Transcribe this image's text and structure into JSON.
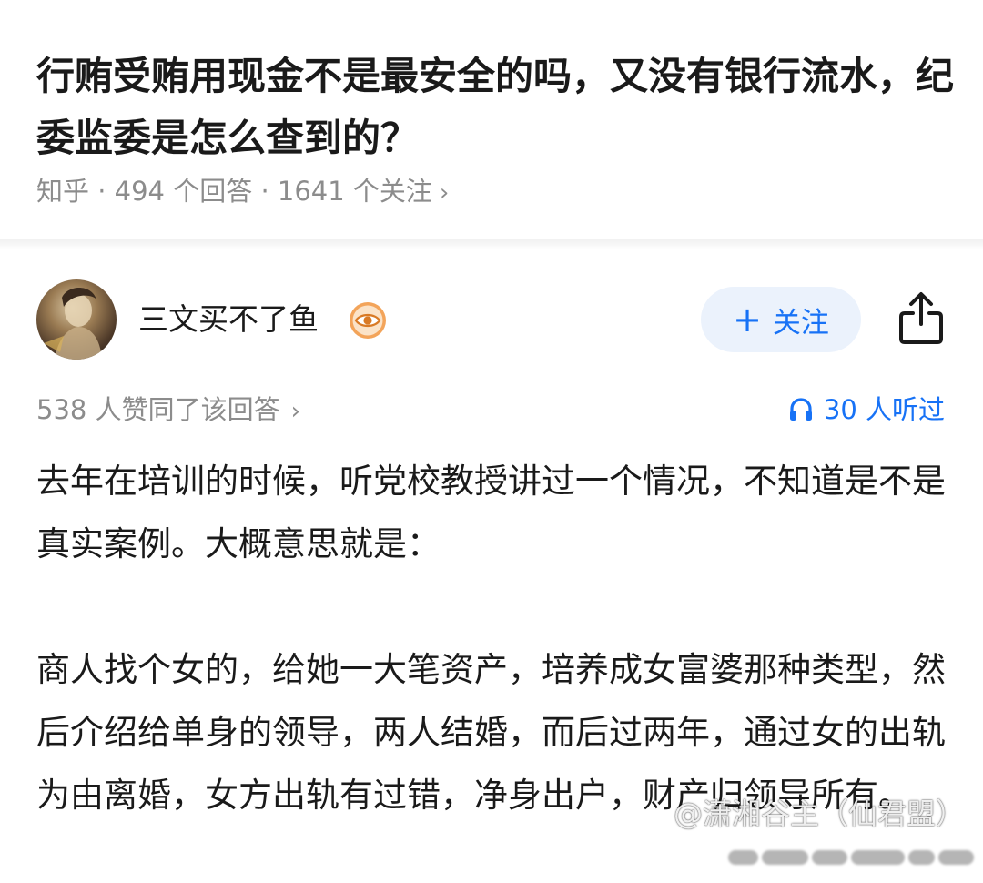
{
  "question": {
    "title": "行贿受贿用现金不是最安全的吗，又没有银行流水，纪委监委是怎么查到的？",
    "meta": "知乎 · 494 个回答 · 1641 个关注",
    "chevron": "›"
  },
  "author": {
    "name": "三文买不了鱼",
    "badge_icon": "eye-badge-icon",
    "follow_label": "关注",
    "follow_plus": "+",
    "share_icon": "share-icon"
  },
  "stats": {
    "agree": "538 人赞同了该回答",
    "chevron": "›",
    "listen": "30 人听过",
    "listen_icon": "headphones-icon"
  },
  "answer": {
    "paragraphs": [
      "去年在培训的时候，听党校教授讲过一个情况，不知道是不是真实案例。大概意思就是：",
      "商人找个女的，给她一大笔资产，培养成女富婆那种类型，然后介绍给单身的领导，两人结婚，而后过两年，通过女的出轨为由离婚，女方出轨有过错，净身出户，财产归领导所有。"
    ]
  },
  "watermark": {
    "text": "@潇湘谷主（仙君盟）"
  },
  "colors": {
    "accent": "#1772f6",
    "follow_bg": "#ebf2fc",
    "meta_gray": "#8c8c8c",
    "text": "#1a1a1a"
  }
}
